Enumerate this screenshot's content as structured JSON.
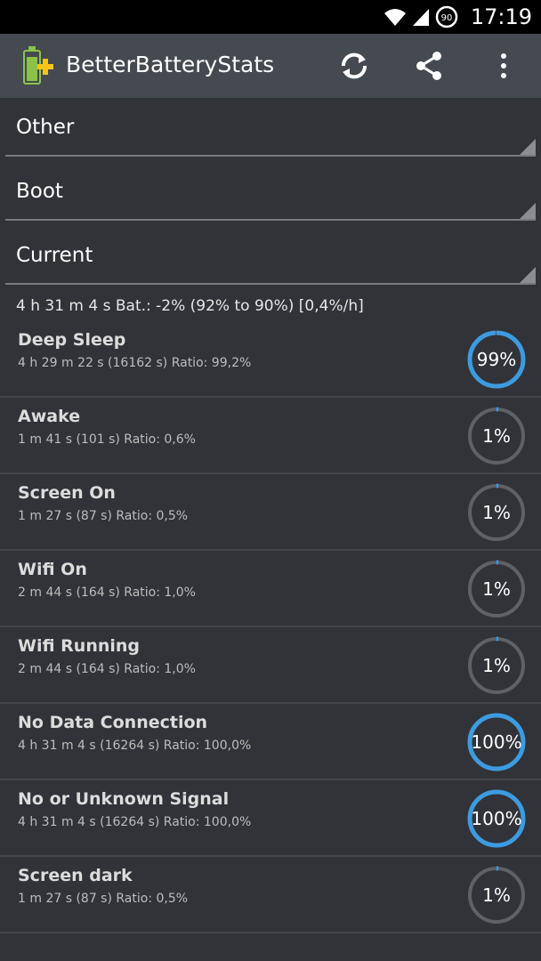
{
  "status_bar": {
    "time": "17:19",
    "battery_level": "90",
    "icons": [
      "wifi-icon",
      "signal-icon",
      "battery-icon"
    ]
  },
  "app_bar": {
    "title": "BetterBatteryStats",
    "actions": [
      "refresh-icon",
      "share-icon",
      "more-vert-icon"
    ]
  },
  "filters": [
    {
      "label": "Other"
    },
    {
      "label": "Boot"
    },
    {
      "label": "Current"
    }
  ],
  "summary": "4 h 31 m 4 s  Bat.: -2% (92% to 90%) [0,4%/h]",
  "colors": {
    "accent": "#3d9be0",
    "ring_track": "#5f6166",
    "background": "#313338",
    "app_bar": "#454a50"
  },
  "items": [
    {
      "name": "Deep Sleep",
      "detail": "4 h 29 m 22 s  (16162 s) Ratio: 99,2%",
      "percent_label": "99%",
      "ratio": 0.992
    },
    {
      "name": "Awake",
      "detail": "1 m 41 s  (101 s) Ratio: 0,6%",
      "percent_label": "1%",
      "ratio": 0.006
    },
    {
      "name": "Screen On",
      "detail": "1 m 27 s  (87 s) Ratio: 0,5%",
      "percent_label": "1%",
      "ratio": 0.005
    },
    {
      "name": "Wifi On",
      "detail": "2 m 44 s  (164 s) Ratio: 1,0%",
      "percent_label": "1%",
      "ratio": 0.01
    },
    {
      "name": "Wifi Running",
      "detail": "2 m 44 s  (164 s) Ratio: 1,0%",
      "percent_label": "1%",
      "ratio": 0.01
    },
    {
      "name": "No Data Connection",
      "detail": "4 h 31 m 4 s  (16264 s) Ratio: 100,0%",
      "percent_label": "100%",
      "ratio": 1.0
    },
    {
      "name": "No or Unknown Signal",
      "detail": "4 h 31 m 4 s  (16264 s) Ratio: 100,0%",
      "percent_label": "100%",
      "ratio": 1.0
    },
    {
      "name": "Screen dark",
      "detail": "1 m 27 s  (87 s) Ratio: 0,5%",
      "percent_label": "1%",
      "ratio": 0.005
    }
  ]
}
